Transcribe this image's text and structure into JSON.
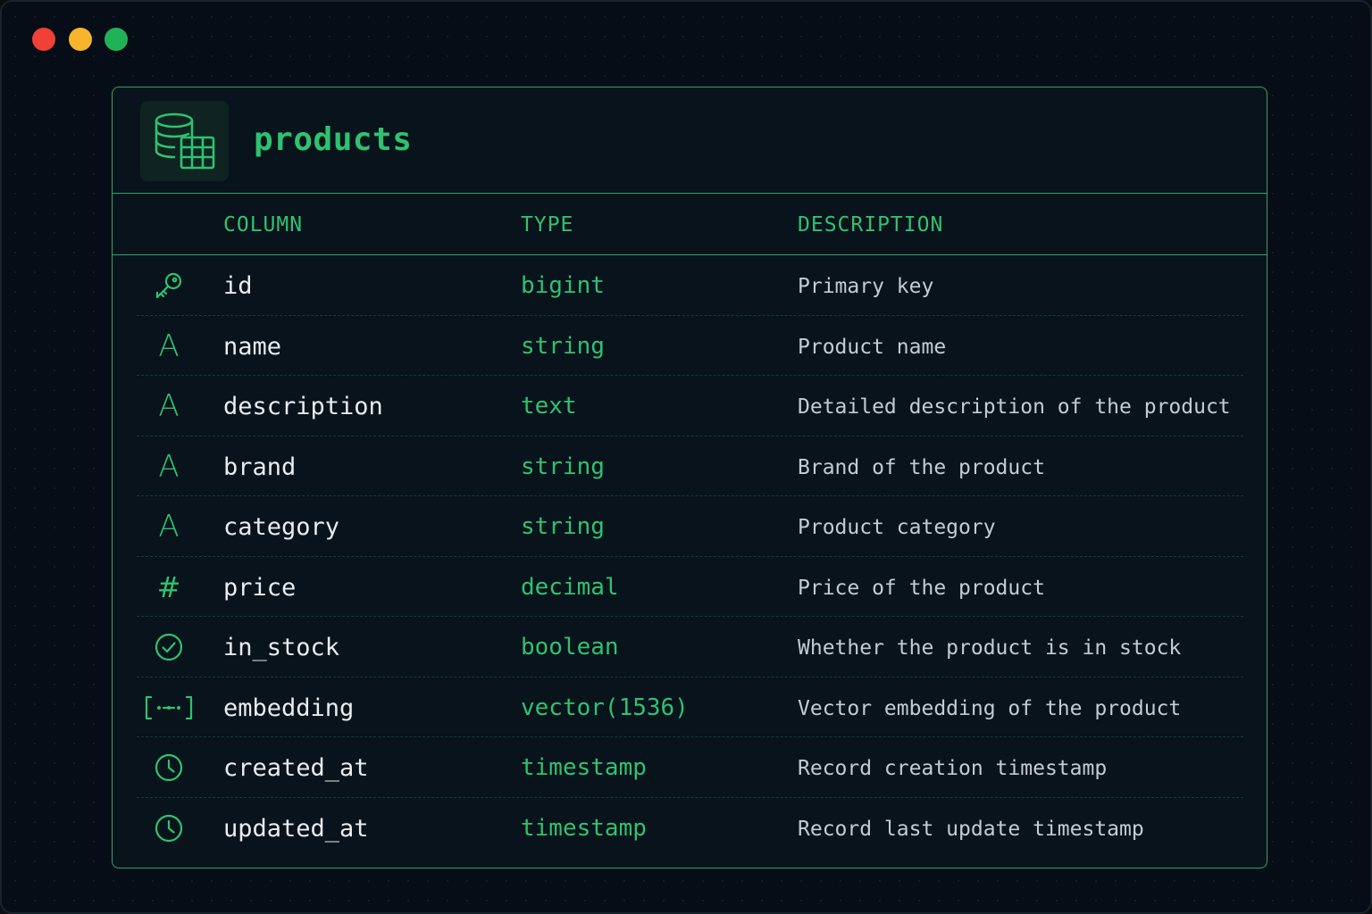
{
  "window": {
    "controls": [
      "close",
      "minimize",
      "maximize"
    ]
  },
  "table": {
    "name": "products",
    "icon": "database-table-icon",
    "headers": {
      "column": "COLUMN",
      "type": "TYPE",
      "description": "DESCRIPTION"
    },
    "rows": [
      {
        "icon": "key-icon",
        "name": "id",
        "type": "bigint",
        "description": "Primary key"
      },
      {
        "icon": "text-icon",
        "name": "name",
        "type": "string",
        "description": "Product name"
      },
      {
        "icon": "text-icon",
        "name": "description",
        "type": "text",
        "description": "Detailed description of the product"
      },
      {
        "icon": "text-icon",
        "name": "brand",
        "type": "string",
        "description": "Brand of the product"
      },
      {
        "icon": "text-icon",
        "name": "category",
        "type": "string",
        "description": "Product category"
      },
      {
        "icon": "hash-icon",
        "name": "price",
        "type": "decimal",
        "description": "Price of the product"
      },
      {
        "icon": "check-circle-icon",
        "name": "in_stock",
        "type": "boolean",
        "description": "Whether the product is in stock"
      },
      {
        "icon": "vector-icon",
        "name": "embedding",
        "type": "vector(1536)",
        "description": "Vector embedding of the product"
      },
      {
        "icon": "clock-icon",
        "name": "created_at",
        "type": "timestamp",
        "description": "Record creation timestamp"
      },
      {
        "icon": "clock-icon",
        "name": "updated_at",
        "type": "timestamp",
        "description": "Record last update timestamp"
      }
    ]
  },
  "colors": {
    "accent": "#2fc26f",
    "border": "#2ea663",
    "background": "#060d16",
    "card": "#08131c",
    "text": "#e9edf0",
    "muted": "#c4ccd2",
    "close": "#ef4136",
    "minimize": "#f6b52d",
    "maximize": "#20b256"
  }
}
